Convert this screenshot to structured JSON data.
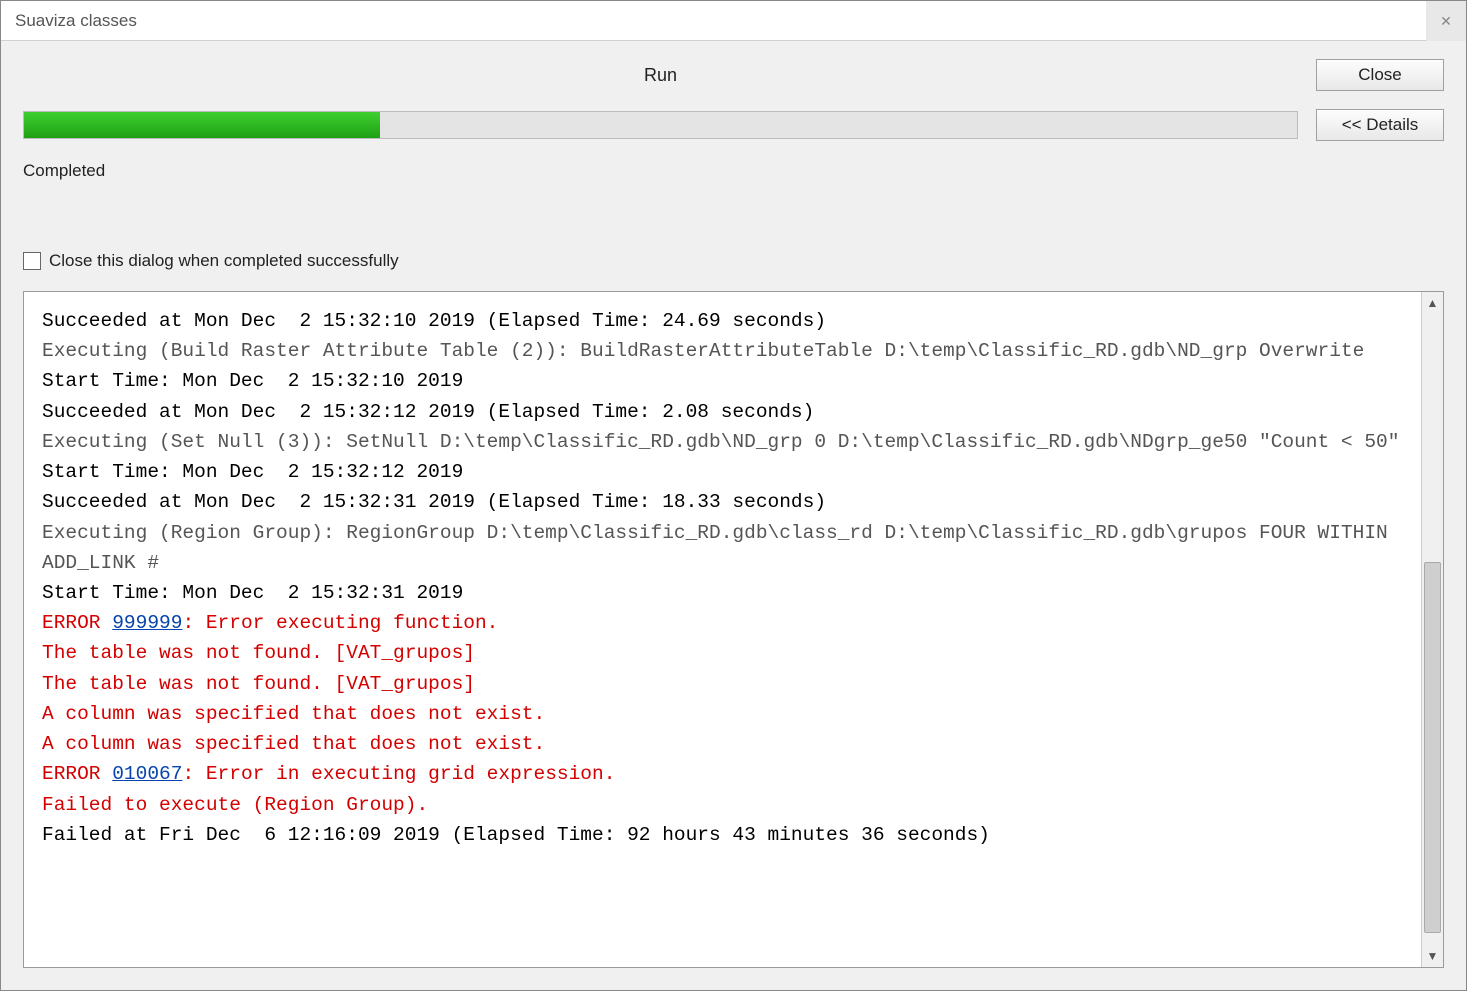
{
  "window": {
    "title": "Suaviza classes"
  },
  "header": {
    "run_label": "Run",
    "close_label": "Close",
    "details_label": "<< Details",
    "status_text": "Completed",
    "checkbox_label": "Close this dialog when completed successfully",
    "progress_percent": 28
  },
  "log": {
    "lines": [
      {
        "style": "bold",
        "text": "Succeeded at Mon Dec  2 15:32:10 2019 (Elapsed Time: 24.69 seconds)"
      },
      {
        "style": "grey",
        "text": "Executing (Build Raster Attribute Table (2)): BuildRasterAttributeTable D:\\temp\\Classific_RD.gdb\\ND_grp Overwrite"
      },
      {
        "style": "bold",
        "text": "Start Time: Mon Dec  2 15:32:10 2019"
      },
      {
        "style": "bold",
        "text": "Succeeded at Mon Dec  2 15:32:12 2019 (Elapsed Time: 2.08 seconds)"
      },
      {
        "style": "grey",
        "text": "Executing (Set Null (3)): SetNull D:\\temp\\Classific_RD.gdb\\ND_grp 0 D:\\temp\\Classific_RD.gdb\\NDgrp_ge50 \"Count < 50\""
      },
      {
        "style": "bold",
        "text": "Start Time: Mon Dec  2 15:32:12 2019"
      },
      {
        "style": "bold",
        "text": "Succeeded at Mon Dec  2 15:32:31 2019 (Elapsed Time: 18.33 seconds)"
      },
      {
        "style": "grey",
        "text": "Executing (Region Group): RegionGroup D:\\temp\\Classific_RD.gdb\\class_rd D:\\temp\\Classific_RD.gdb\\grupos FOUR WITHIN ADD_LINK #"
      },
      {
        "style": "bold",
        "text": "Start Time: Mon Dec  2 15:32:31 2019"
      },
      {
        "style": "error_link",
        "prefix": "ERROR ",
        "code": "999999",
        "suffix": ": Error executing function."
      },
      {
        "style": "red",
        "text": "The table was not found. [VAT_grupos]"
      },
      {
        "style": "red",
        "text": "The table was not found. [VAT_grupos]"
      },
      {
        "style": "red",
        "text": "A column was specified that does not exist."
      },
      {
        "style": "red",
        "text": "A column was specified that does not exist."
      },
      {
        "style": "error_link",
        "prefix": "ERROR ",
        "code": "010067",
        "suffix": ": Error in executing grid expression."
      },
      {
        "style": "red",
        "text": "Failed to execute (Region Group)."
      },
      {
        "style": "bold",
        "text": "Failed at Fri Dec  6 12:16:09 2019 (Elapsed Time: 92 hours 43 minutes 36 seconds)"
      }
    ]
  }
}
